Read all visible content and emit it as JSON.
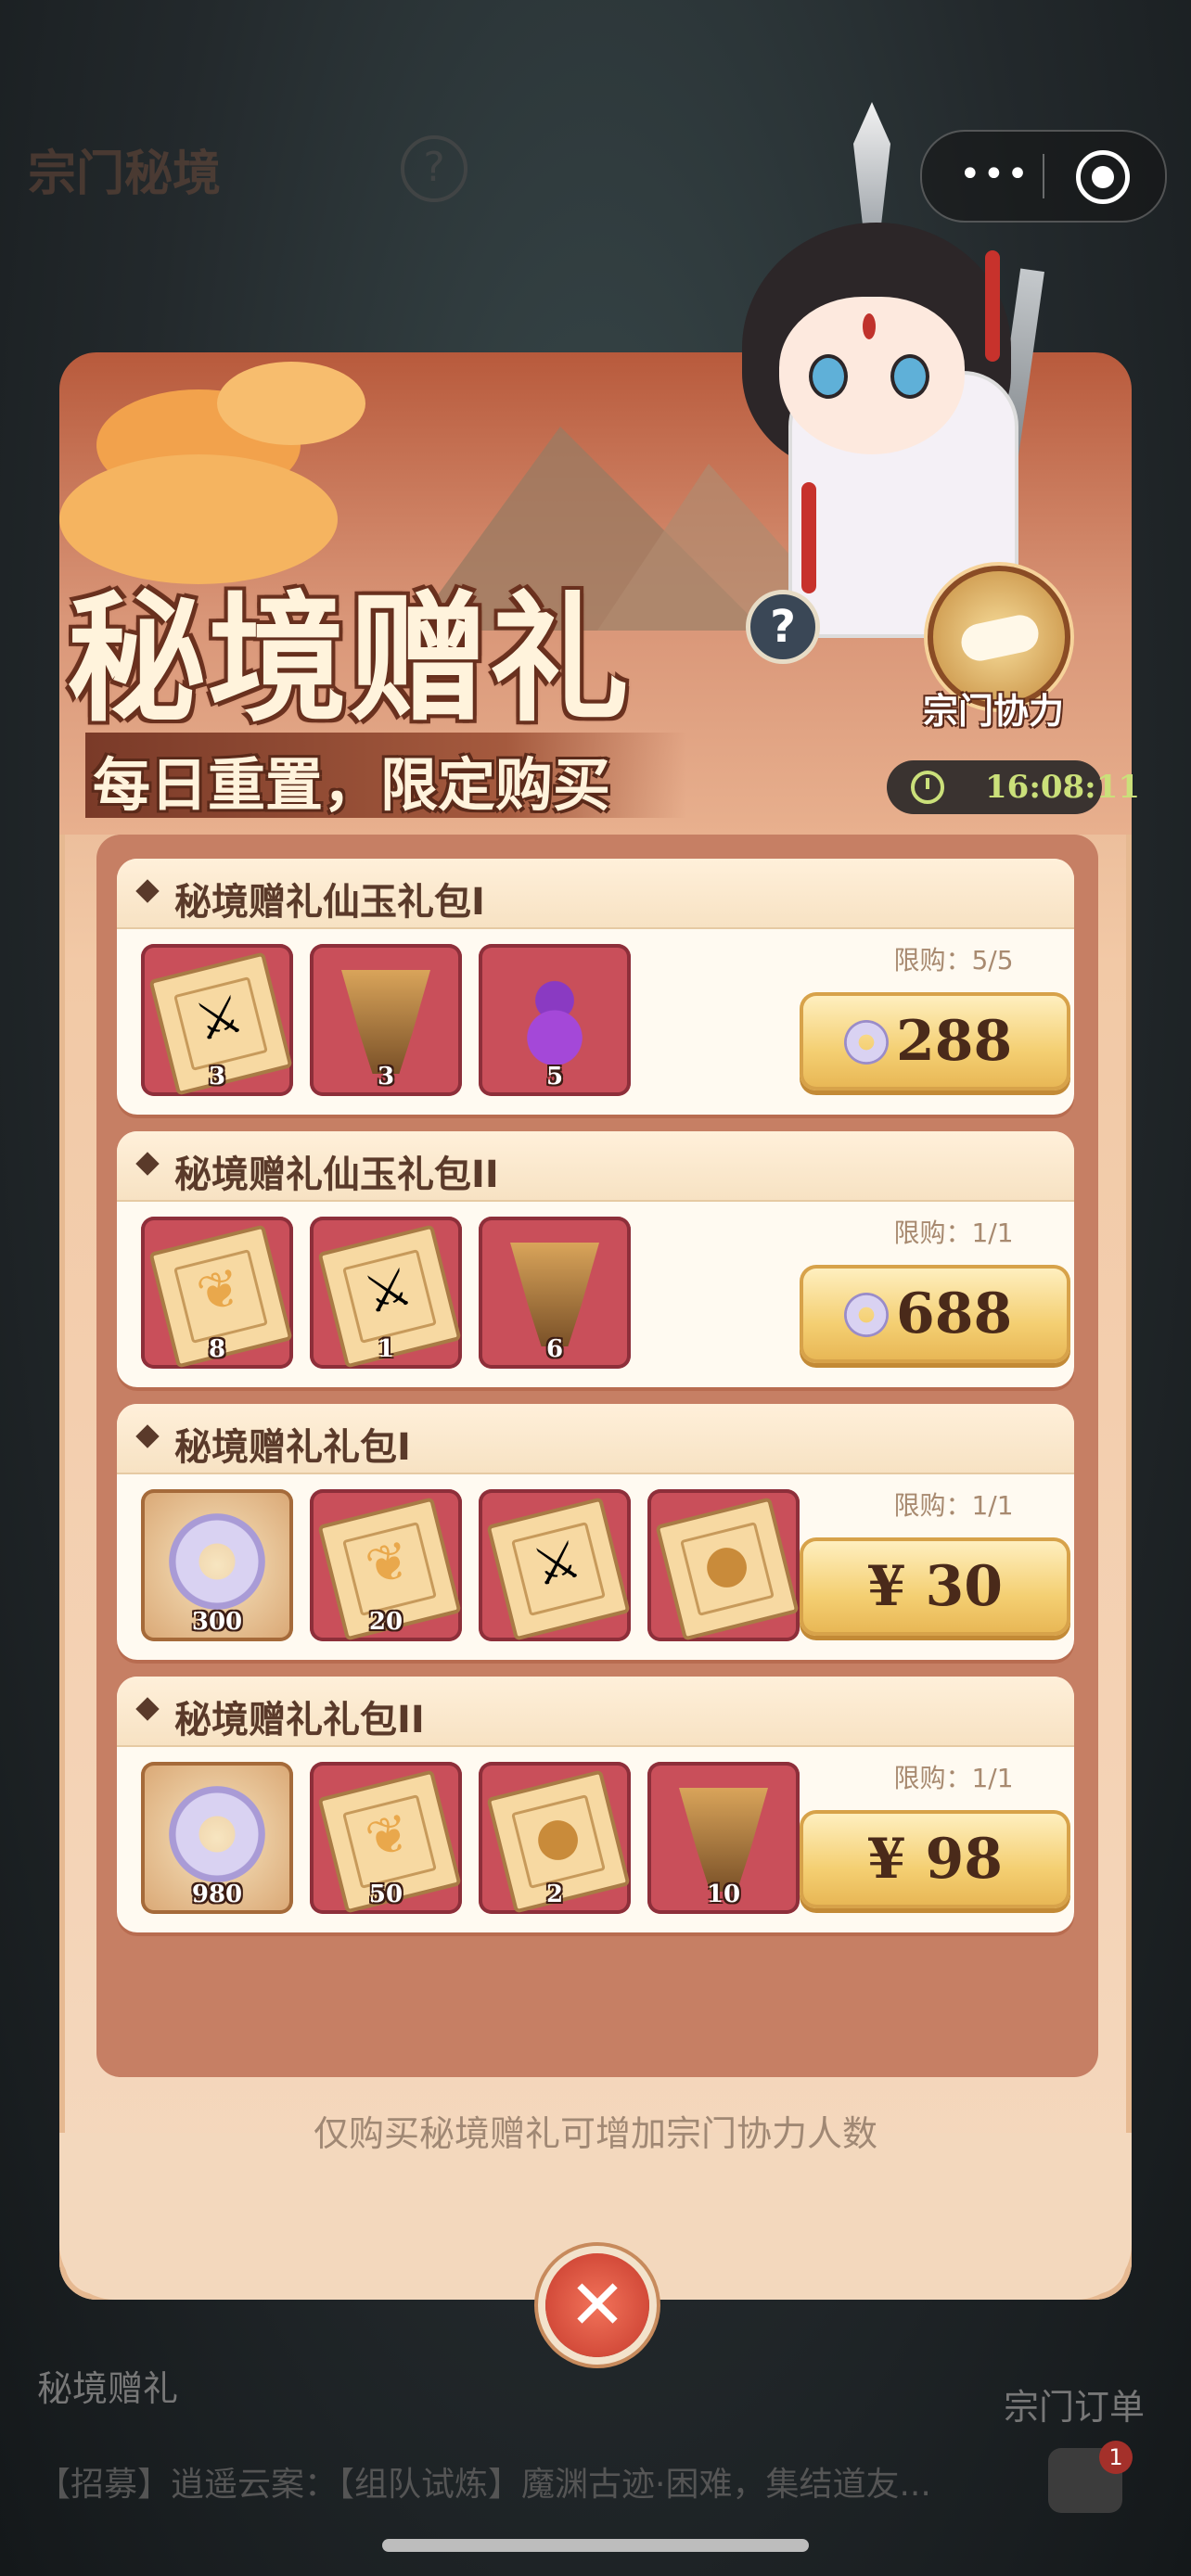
{
  "background": {
    "title": "宗门秘境",
    "left_label": "秘境赠礼",
    "right_label": "宗门订单",
    "marquee": "【招募】逍遥云案：【组队试炼】魔渊古迹·困难，集结道友...",
    "chat_badge": "1"
  },
  "capsule": {
    "more_label": "•••"
  },
  "popup": {
    "title": "秘境赠礼",
    "help": "?",
    "subtitle": "每日重置，限定购买",
    "coop_label": "宗门协力",
    "timer": "16:08:11",
    "note": "仅购买秘境赠礼可增加宗门协力人数",
    "close": "✕"
  },
  "packs": [
    {
      "name": "秘境赠礼仙玉礼包I",
      "limit": "限购：5/5",
      "price": "288",
      "price_type": "jade",
      "items": [
        {
          "icon": "sword-scroll-icon",
          "count": "3"
        },
        {
          "icon": "bronze-cup-icon",
          "count": "3"
        },
        {
          "icon": "purple-gourd-icon",
          "count": "5"
        }
      ]
    },
    {
      "name": "秘境赠礼仙玉礼包II",
      "limit": "限购：1/1",
      "price": "688",
      "price_type": "jade",
      "items": [
        {
          "icon": "herb-scroll-icon",
          "count": "8"
        },
        {
          "icon": "sword-scroll-icon",
          "count": "1"
        },
        {
          "icon": "bronze-cup-icon",
          "count": "6"
        }
      ]
    },
    {
      "name": "秘境赠礼礼包I",
      "limit": "限购：1/1",
      "price": "¥ 30",
      "price_type": "cash",
      "items": [
        {
          "icon": "jade-ring-icon",
          "count": "300"
        },
        {
          "icon": "herb-scroll-icon",
          "count": "20"
        },
        {
          "icon": "sword-scroll-icon",
          "count": ""
        },
        {
          "icon": "cookie-scroll-icon",
          "count": ""
        }
      ]
    },
    {
      "name": "秘境赠礼礼包II",
      "limit": "限购：1/1",
      "price": "¥ 98",
      "price_type": "cash",
      "items": [
        {
          "icon": "jade-ring-icon",
          "count": "980"
        },
        {
          "icon": "herb-scroll-icon",
          "count": "50"
        },
        {
          "icon": "cookie-scroll-icon",
          "count": "2"
        },
        {
          "icon": "bronze-cup-icon",
          "count": "10"
        }
      ]
    }
  ]
}
